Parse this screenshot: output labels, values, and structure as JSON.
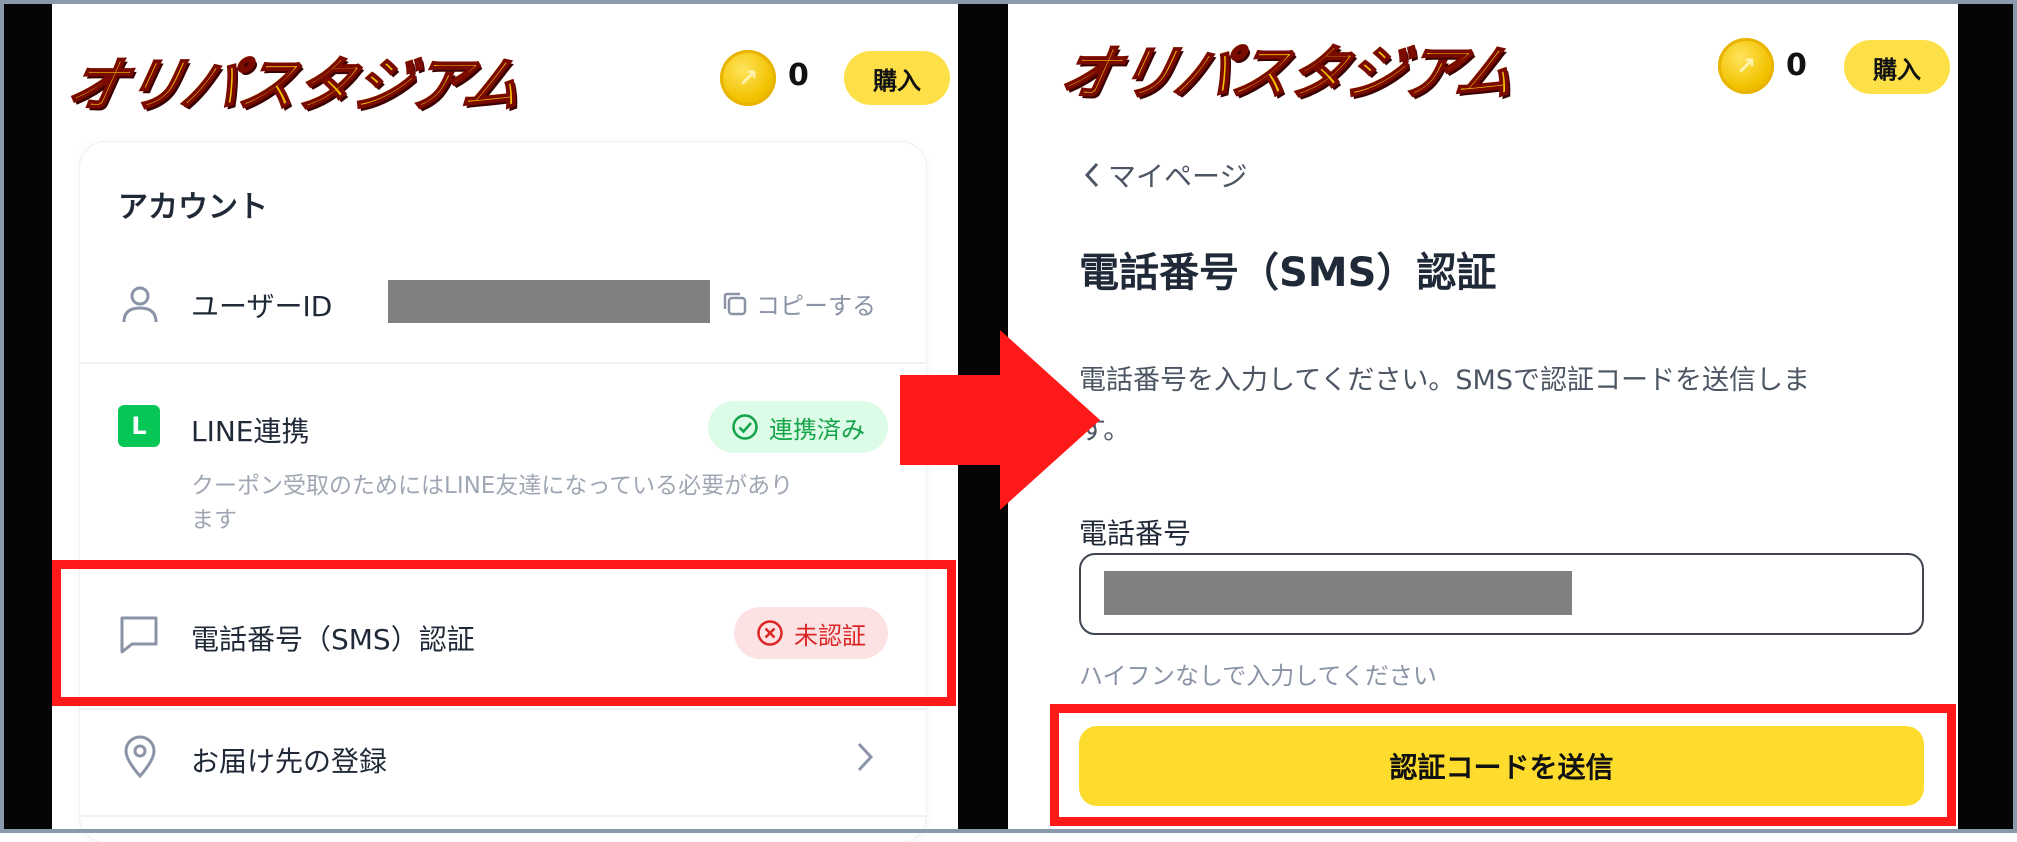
{
  "brand": {
    "logo_text": "オリパスタジアム",
    "coin_count": "0",
    "buy_label": "購入"
  },
  "left_screen": {
    "section_title": "アカウント",
    "user_id": {
      "label": "ユーザーID",
      "copy_label": "コピーする"
    },
    "line": {
      "icon_letter": "L",
      "label": "LINE連携",
      "status": "連携済み",
      "note_line1": "クーポン受取のためにはLINE友達になっている必要があり",
      "note_line2": "ます"
    },
    "sms": {
      "label": "電話番号（SMS）認証",
      "status": "未認証"
    },
    "address": {
      "label": "お届け先の登録"
    }
  },
  "right_screen": {
    "back_label": "マイページ",
    "page_title": "電話番号（SMS）認証",
    "description_line1": "電話番号を入力してください。SMSで認証コードを送信しま",
    "description_line2": "す。",
    "field_label": "電話番号",
    "hint": "ハイフンなしで入力してください",
    "submit_label": "認証コードを送信"
  },
  "colors": {
    "accent_yellow": "#fde047",
    "highlight_red": "#ff1a1a",
    "linked_green": "#16a34a",
    "unverified_red": "#dc2626",
    "line_green": "#06c755"
  }
}
